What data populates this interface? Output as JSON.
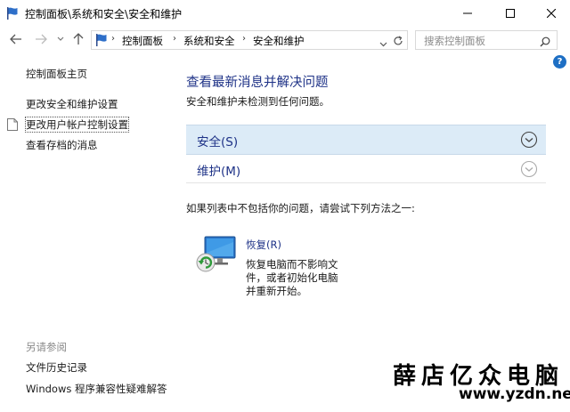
{
  "window": {
    "title": "控制面板\\系统和安全\\安全和维护"
  },
  "address_bar": {
    "crumbs": [
      "控制面板",
      "系统和安全",
      "安全和维护"
    ],
    "search_placeholder": "搜索控制面板"
  },
  "sidebar": {
    "items": [
      {
        "label": "控制面板主页"
      },
      {
        "label": "更改安全和维护设置"
      },
      {
        "label": "更改用户帐户控制设置"
      },
      {
        "label": "查看存档的消息"
      }
    ],
    "see_also_title": "另请参阅",
    "see_also": [
      {
        "label": "文件历史记录"
      },
      {
        "label": "Windows 程序兼容性疑难解答"
      }
    ]
  },
  "main": {
    "title": "查看最新消息并解决问题",
    "subtitle": "安全和维护未检测到任何问题。",
    "sections": [
      {
        "label": "安全(S)"
      },
      {
        "label": "维护(M)"
      }
    ],
    "prompt": "如果列表中不包括你的问题，请尝试下列方法之一:",
    "recovery": {
      "link": "恢复(R)",
      "desc": [
        "恢复电脑而不影响文",
        "件，或者初始化电脑",
        "并重新开始。"
      ]
    }
  },
  "help_label": "?",
  "watermark": {
    "cn": "薛店亿众电脑",
    "url": "www.yzdn.net"
  },
  "colors": {
    "accent": "#1e3287",
    "section_bg": "#dcebf7",
    "help_blue": "#1e6fc4"
  }
}
